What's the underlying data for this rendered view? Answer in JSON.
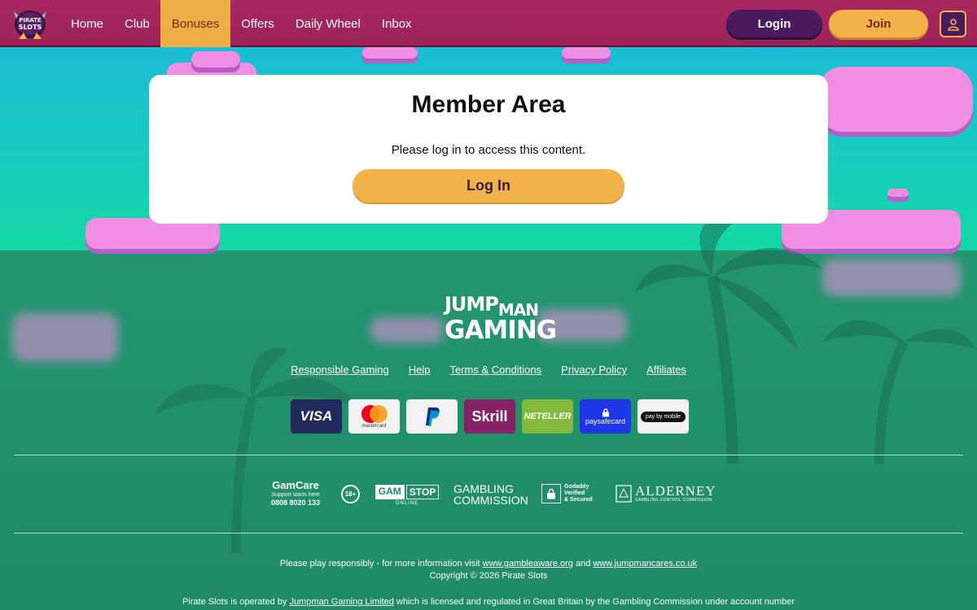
{
  "header": {
    "logo_text": [
      "PIRATE",
      "SLOTS"
    ],
    "nav": [
      {
        "label": "Home",
        "active": false
      },
      {
        "label": "Club",
        "active": false
      },
      {
        "label": "Bonuses",
        "active": true
      },
      {
        "label": "Offers",
        "active": false
      },
      {
        "label": "Daily Wheel",
        "active": false
      },
      {
        "label": "Inbox",
        "active": false
      }
    ],
    "login_label": "Login",
    "join_label": "Join",
    "user_icon": "user-icon"
  },
  "member": {
    "title": "Member Area",
    "message": "Please log in to access this content.",
    "button_label": "Log In"
  },
  "footer": {
    "brand_top": "JUMP",
    "brand_top_small": "MAN",
    "brand_bottom": "GAMING",
    "links": [
      "Responsible Gaming",
      "Help",
      "Terms & Conditions",
      "Privacy Policy",
      "Affiliates"
    ],
    "payments": [
      "VISA",
      "mastercard",
      "PayPal",
      "Skrill",
      "NETELLER",
      "paysafecard",
      "pay by mobile"
    ],
    "regulators": {
      "gamcare_title": "GamCare",
      "gamcare_sub": "Support starts here",
      "gamcare_phone": "0808 8020 133",
      "age": "18+",
      "gamstop_a": "GAM",
      "gamstop_b": "STOP",
      "gamstop_sub": "ONLINE",
      "gc_line1": "GAMBLING",
      "gc_line2": "COMMISSION",
      "godaddy": [
        "Godaddy",
        "Verified",
        "& Secured"
      ],
      "alderney": "ALDERNEY",
      "alderney_sub": "GAMBLING CONTROL COMMISSION"
    },
    "responsible_pre": "Please play responsibly - for more information visit",
    "gambleaware": "www.gambleaware.org",
    "and": "and",
    "jumpmancares": "www.jumpmancares.co.uk",
    "copyright": "Copyright © 2026 Pirate Slots",
    "operated_pre": "Pirate Slots is operated by",
    "operator": "Jumpman Gaming Limited",
    "operated_post": "which is licensed and regulated in Great Britain by the Gambling Commission under account number"
  },
  "colors": {
    "header": "#a8285f",
    "accent": "#f2b24a",
    "dark_purple": "#4b1a5c",
    "sky": "#1fb6e0",
    "ground": "#1f8a68",
    "cloud": "#f08ee3"
  }
}
